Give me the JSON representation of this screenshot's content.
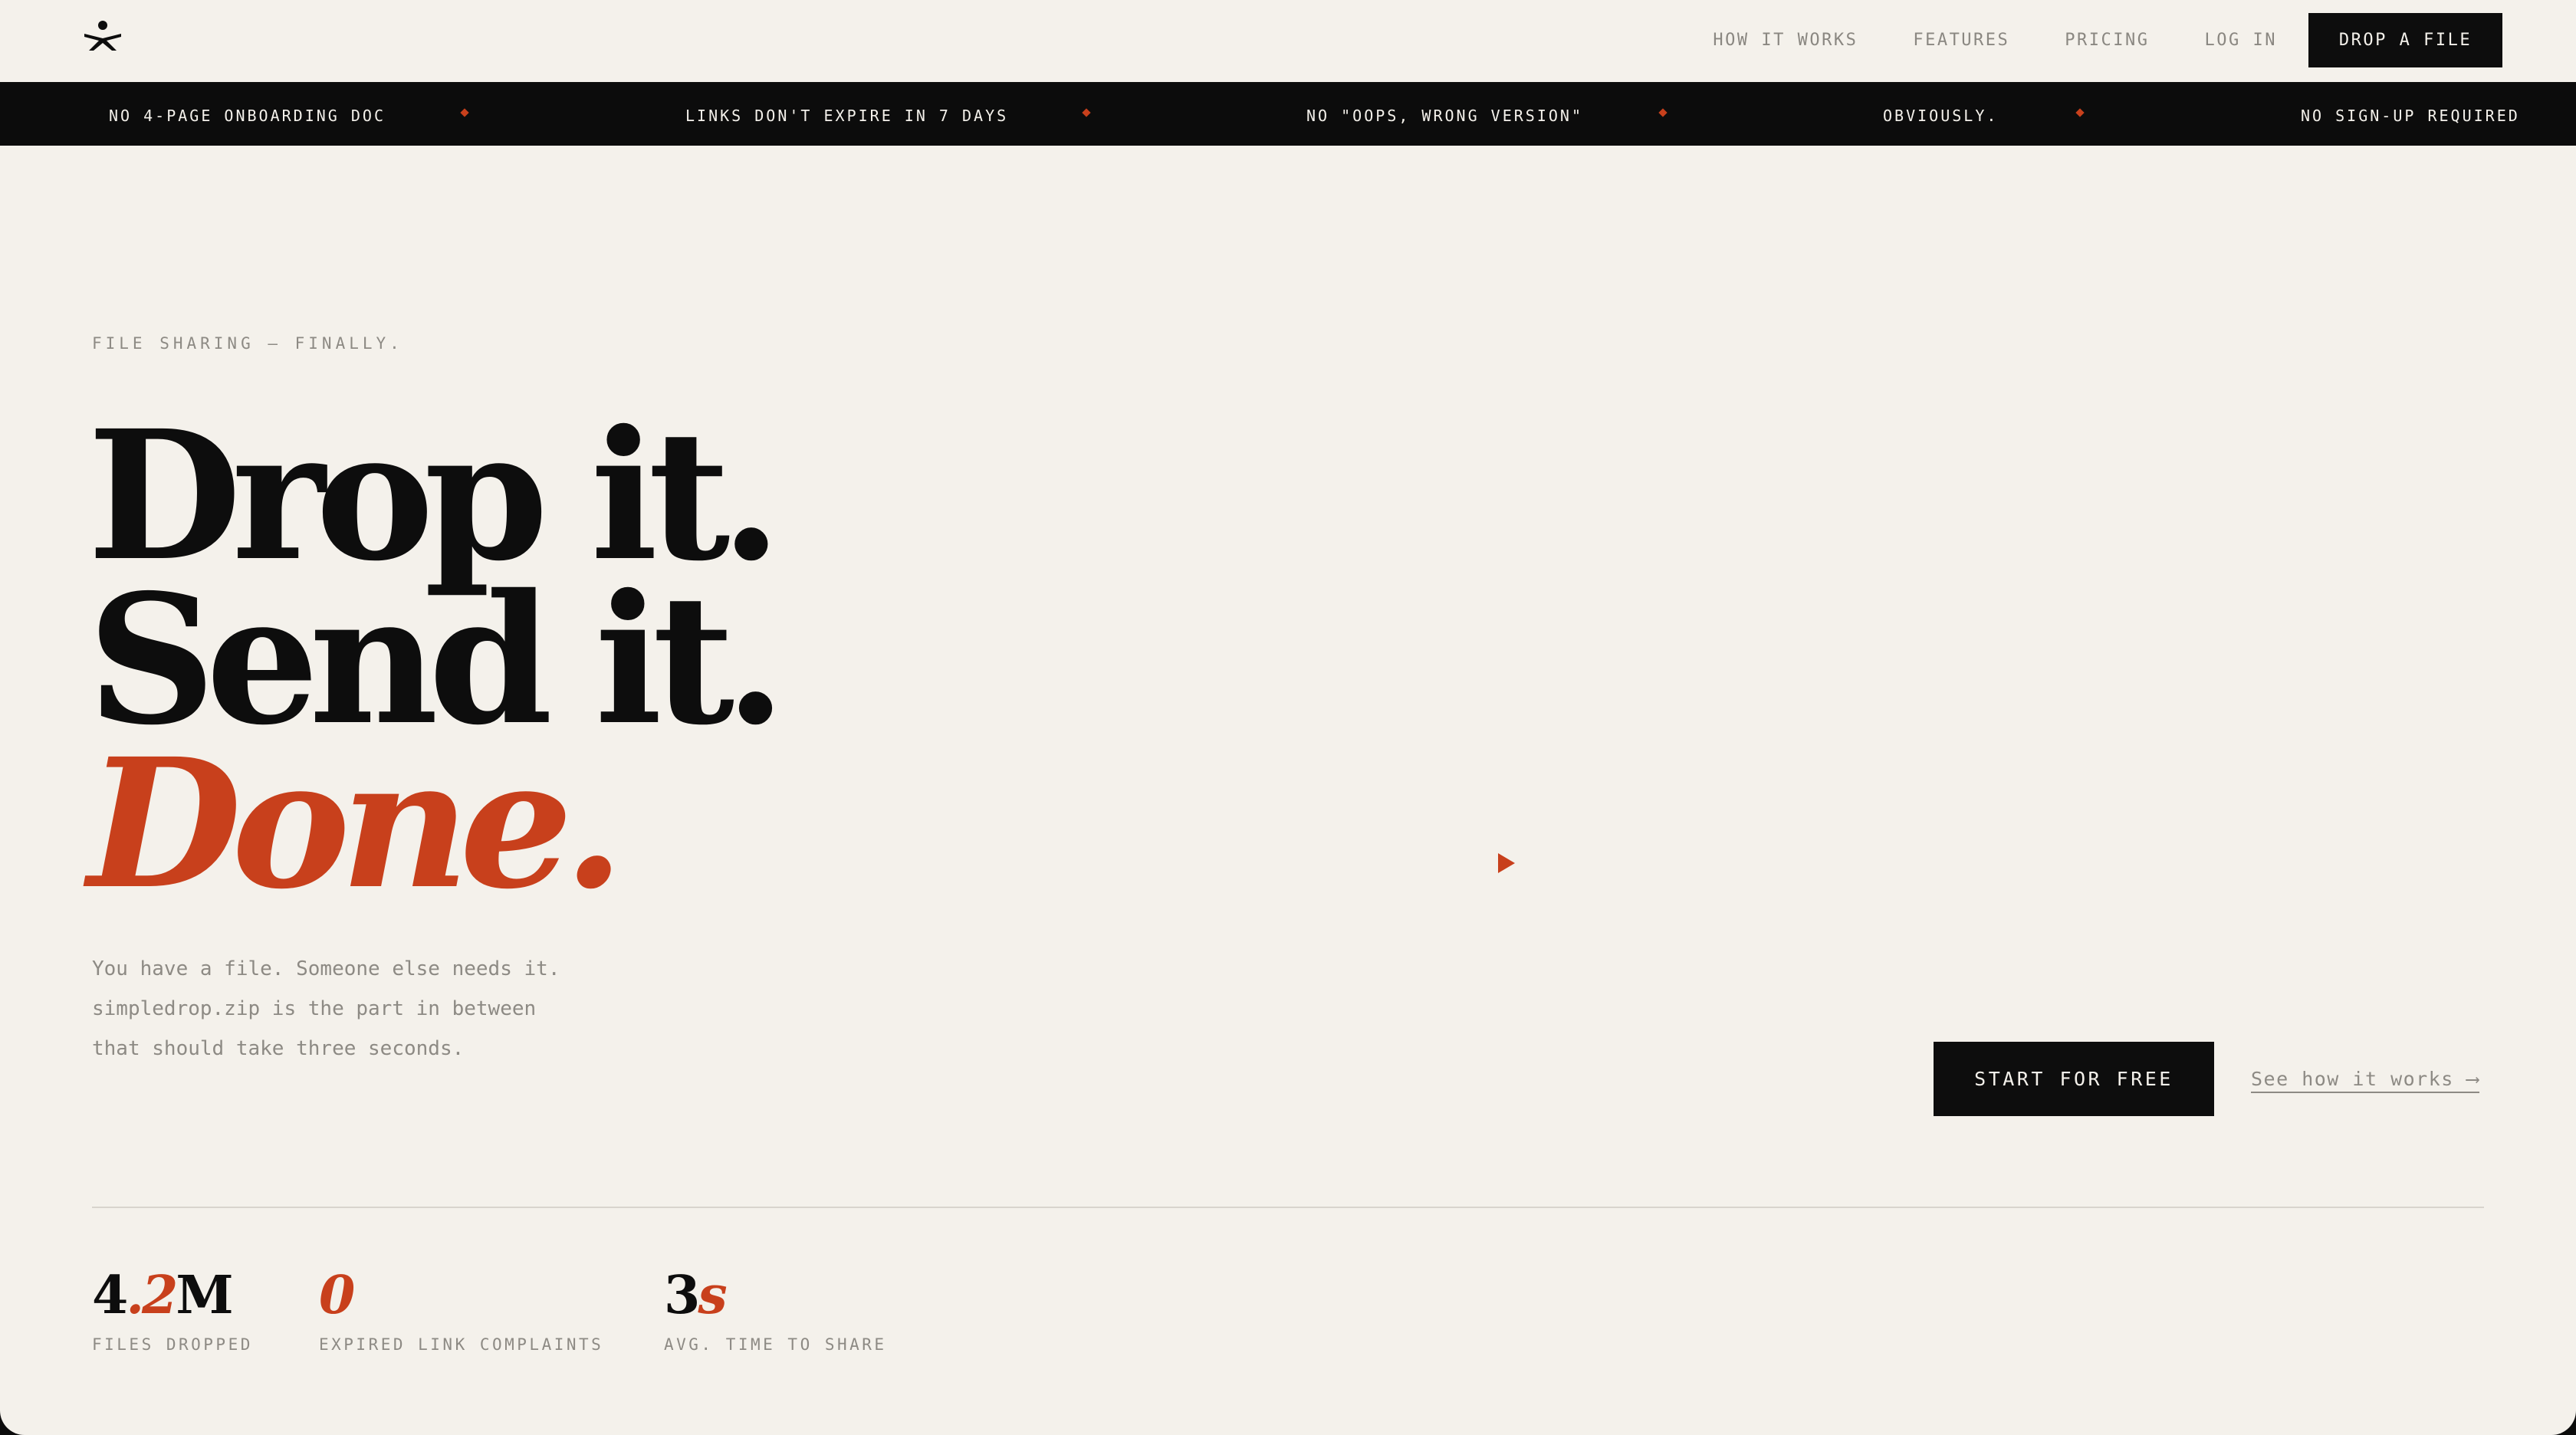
{
  "nav": {
    "logo_icon": "figure-logo-icon",
    "links": [
      "HOW IT WORKS",
      "FEATURES",
      "PRICING",
      "LOG IN"
    ],
    "cta_label": "DROP A FILE"
  },
  "ticker": {
    "items": [
      "NO 4-PAGE ONBOARDING DOC",
      "LINKS DON'T EXPIRE IN 7 DAYS",
      "NO \"OOPS, WRONG VERSION\"",
      "OBVIOUSLY.",
      "NO SIGN-UP REQUIRED"
    ]
  },
  "hero": {
    "eyebrow": "FILE SHARING — FINALLY.",
    "headline_line1": "Drop it.",
    "headline_line2": "Send it.",
    "headline_line3": "Done.",
    "subtext_line1": "You have a file. Someone else needs it.",
    "subtext_line2": "simpledrop.zip is the part in between",
    "subtext_line3": "that should take three seconds.",
    "primary_cta": "START FOR FREE",
    "secondary_cta": "See how it works ⟶",
    "play_icon": "play-icon"
  },
  "stats": [
    {
      "value_main": "4",
      "value_accent": ".2",
      "value_suffix": "M",
      "label": "FILES DROPPED"
    },
    {
      "value_main": "",
      "value_accent": "0",
      "value_suffix": "",
      "label": "EXPIRED LINK COMPLAINTS"
    },
    {
      "value_main": "3",
      "value_accent": "s",
      "value_suffix": "",
      "label": "AVG. TIME TO SHARE"
    }
  ],
  "colors": {
    "background": "#f4f1eb",
    "ink": "#0d0d0d",
    "accent": "#c8401c",
    "muted": "#8d8a84"
  }
}
